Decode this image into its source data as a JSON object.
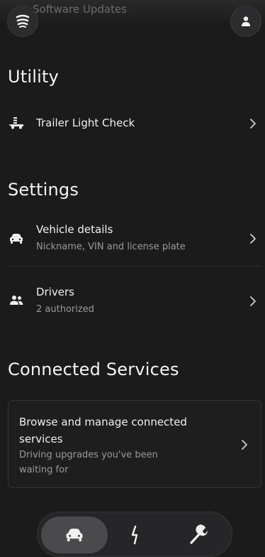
{
  "header": {
    "title": "Software Updates",
    "menu_icon": "tesla-logo-icon",
    "profile_icon": "person-icon"
  },
  "utility": {
    "title": "Utility",
    "items": [
      {
        "label": "Trailer Light Check",
        "icon": "trailer-icon"
      }
    ]
  },
  "settings": {
    "title": "Settings",
    "items": [
      {
        "label": "Vehicle details",
        "sub": "Nickname, VIN and license plate",
        "icon": "car-icon"
      },
      {
        "label": "Drivers",
        "sub": "2 authorized",
        "icon": "people-icon"
      }
    ]
  },
  "connected": {
    "title": "Connected Services",
    "card_title": "Browse and manage connected services",
    "card_sub": "Driving upgrades you've been waiting for"
  },
  "bottom_nav": {
    "items": [
      "car-icon",
      "lightning-icon",
      "wrench-icon"
    ],
    "active": "car-icon"
  },
  "colors": {
    "background": "#1b1b1c",
    "text_primary": "#f2f2f2",
    "text_secondary": "#9a9a9c",
    "active_pill": "#4a4a4c"
  }
}
